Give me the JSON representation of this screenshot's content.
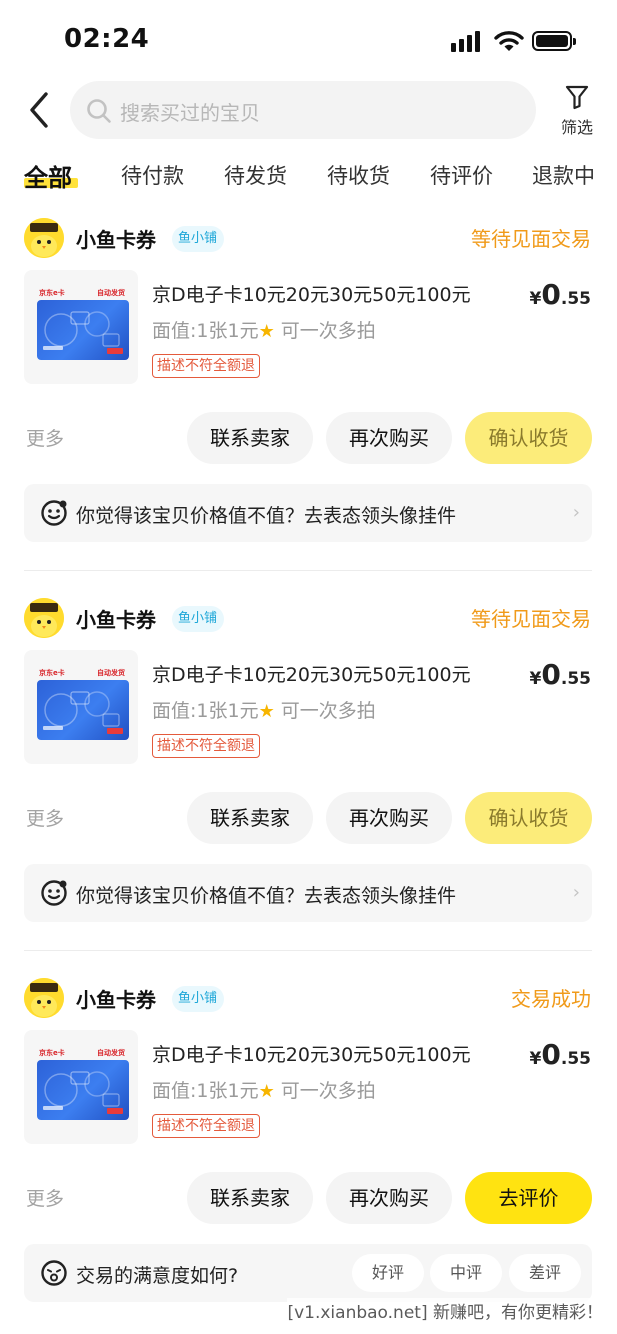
{
  "status_bar": {
    "time": "02:24",
    "icons": [
      "signal-icon",
      "wifi-icon",
      "battery-icon"
    ]
  },
  "header": {
    "back_icon": "chevron-left-icon",
    "search_placeholder": "搜索买过的宝贝",
    "filter_label": "筛选"
  },
  "tabs": [
    {
      "label": "全部",
      "active": true
    },
    {
      "label": "待付款"
    },
    {
      "label": "待发货"
    },
    {
      "label": "待收货"
    },
    {
      "label": "待评价"
    },
    {
      "label": "退款中"
    }
  ],
  "orders": [
    {
      "shop_name": "小鱼卡券",
      "shop_badge": "鱼小铺",
      "status": "等待见面交易",
      "item_title": "京D电子卡10元20元30元50元100元",
      "item_spec": "面值:1张1元",
      "item_spec_suffix": "可一次多拍",
      "item_tag": "描述不符全额退",
      "price_currency": "¥",
      "price_int": "0",
      "price_dec": ".55",
      "more_label": "更多",
      "btn_contact": "联系卖家",
      "btn_rebuy": "再次购买",
      "btn_primary": "确认收货",
      "prompt": "你觉得该宝贝价格值不值？去表态领头像挂件"
    },
    {
      "shop_name": "小鱼卡券",
      "shop_badge": "鱼小铺",
      "status": "等待见面交易",
      "item_title": "京D电子卡10元20元30元50元100元",
      "item_spec": "面值:1张1元",
      "item_spec_suffix": "可一次多拍",
      "item_tag": "描述不符全额退",
      "price_currency": "¥",
      "price_int": "0",
      "price_dec": ".55",
      "more_label": "更多",
      "btn_contact": "联系卖家",
      "btn_rebuy": "再次购买",
      "btn_primary": "确认收货",
      "prompt": "你觉得该宝贝价格值不值？去表态领头像挂件"
    },
    {
      "shop_name": "小鱼卡券",
      "shop_badge": "鱼小铺",
      "status": "交易成功",
      "item_title": "京D电子卡10元20元30元50元100元",
      "item_spec": "面值:1张1元",
      "item_spec_suffix": "可一次多拍",
      "item_tag": "描述不符全额退",
      "price_currency": "¥",
      "price_int": "0",
      "price_dec": ".55",
      "more_label": "更多",
      "btn_contact": "联系卖家",
      "btn_rebuy": "再次购买",
      "btn_primary": "去评价",
      "prompt": "交易的满意度如何?",
      "ratings": [
        "好评",
        "中评",
        "差评"
      ]
    }
  ],
  "card_image": {
    "brand": "京东e卡",
    "tag": "自动发货"
  },
  "watermark": "[v1.xianbao.net] 新赚吧，有你更精彩！",
  "colors": {
    "accent_yellow": "#ffe311",
    "status_orange": "#f09a19",
    "tag_red": "#e45a3c",
    "badge_blue": "#1ea7d8"
  }
}
